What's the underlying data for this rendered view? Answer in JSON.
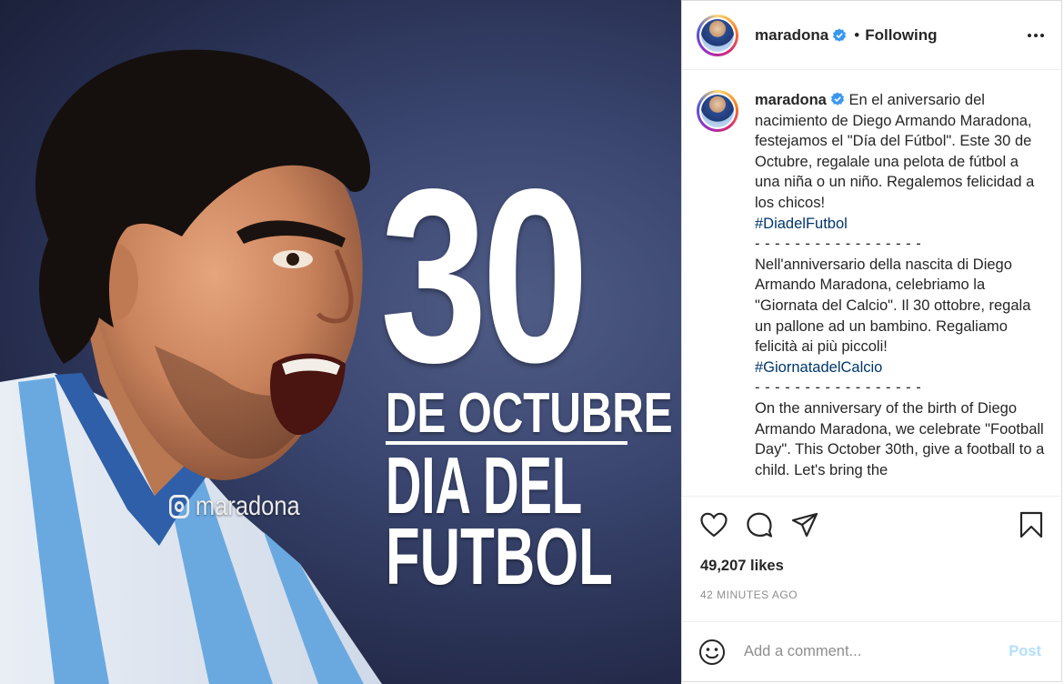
{
  "image": {
    "number": "30",
    "line1": "DE OCTUBRE",
    "line2": "DIA DEL",
    "line3": "FUTBOL",
    "watermark": "maradona"
  },
  "header": {
    "username": "maradona",
    "separator": "•",
    "follow_status": "Following"
  },
  "caption": {
    "username": "maradona",
    "paragraph1": "En el aniversario del nacimiento de Diego Armando Maradona, festejamos el \"Día del Fútbol\". Este 30 de Octubre, regalale una pelota de fútbol a una niña o un niño. Regalemos felicidad a los chicos!",
    "hashtag1": "#DiadelFutbol",
    "separator1": "- - - - - - - - - - - - - - - - -",
    "paragraph2": "Nell'anniversario della nascita di Diego Armando Maradona, celebriamo la \"Giornata del Calcio\". Il 30 ottobre, regala un pallone ad un bambino. Regaliamo felicità ai più piccoli!",
    "hashtag2": "#GiornatadelCalcio",
    "separator2": "- - - - - - - - - - - - - - - - -",
    "paragraph3": "On the anniversary of the birth of Diego Armando Maradona, we celebrate \"Football Day\". This October 30th, give a football to a child. Let's bring the"
  },
  "actions": {
    "icons": [
      "heart-icon",
      "comment-icon",
      "share-icon",
      "bookmark-icon"
    ]
  },
  "stats": {
    "likes": "49,207 likes",
    "time": "42 MINUTES AGO"
  },
  "add_comment": {
    "placeholder": "Add a comment...",
    "post_label": "Post"
  },
  "colors": {
    "verified": "#3897f0",
    "hashtag": "#00376b",
    "post_disabled": "#b2dffc",
    "muted": "#8e8e8e"
  }
}
